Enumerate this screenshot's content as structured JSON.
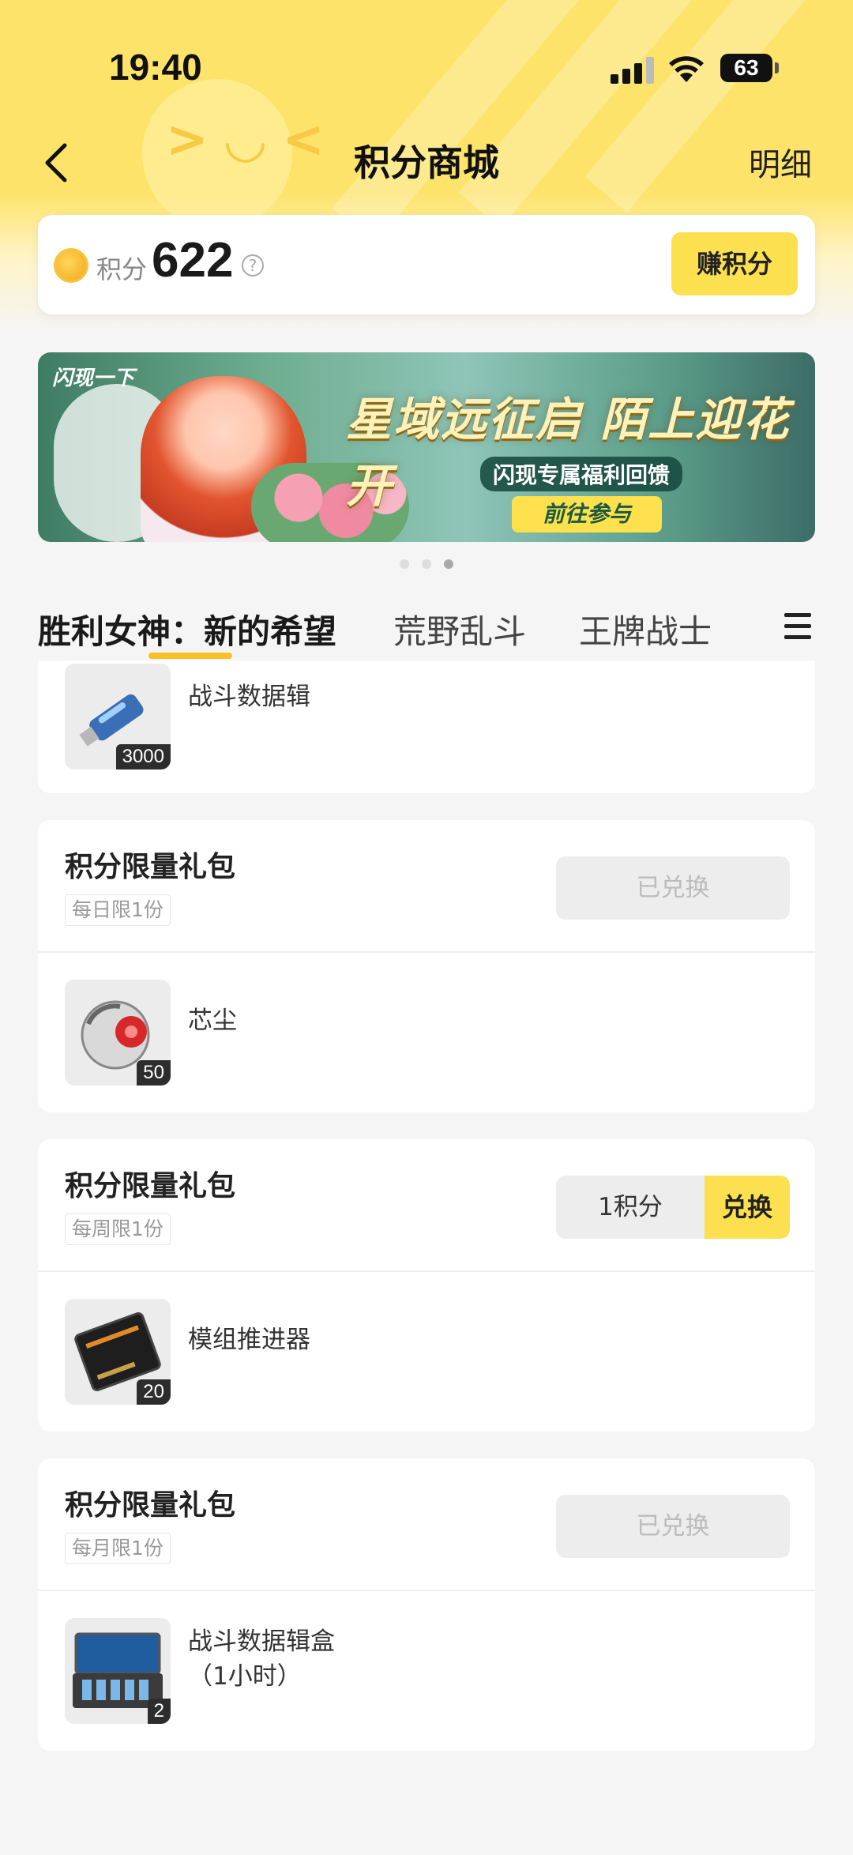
{
  "status_bar": {
    "time": "19:40",
    "battery": "63"
  },
  "nav": {
    "title": "积分商城",
    "detail": "明细"
  },
  "points": {
    "label": "积分",
    "value": "622",
    "earn_button": "赚积分"
  },
  "banner": {
    "logo": "闪现一下",
    "title": "星域远征启 陌上迎花开",
    "subtitle": "闪现专属福利回馈",
    "cta": "前往参与"
  },
  "tabs": [
    "胜利女神：新的希望",
    "荒野乱斗",
    "王牌战士"
  ],
  "partial_item": {
    "name": "战斗数据辑",
    "qty": "3000"
  },
  "gifts": [
    {
      "title": "积分限量礼包",
      "limit": "每日限1份",
      "button": "已兑换",
      "redeemed": true,
      "item_name": "芯尘",
      "qty": "50"
    },
    {
      "title": "积分限量礼包",
      "limit": "每周限1份",
      "cost": "1积分",
      "button": "兑换",
      "redeemed": false,
      "item_name": "模组推进器",
      "qty": "20"
    },
    {
      "title": "积分限量礼包",
      "limit": "每月限1份",
      "button": "已兑换",
      "redeemed": true,
      "item_name_line1": "战斗数据辑盒",
      "item_name_line2": "（1小时）",
      "qty": "2"
    }
  ],
  "colors": {
    "accent": "#fde04f",
    "header_yellow": "#fde36a",
    "tab_underline": "#f8c227"
  }
}
